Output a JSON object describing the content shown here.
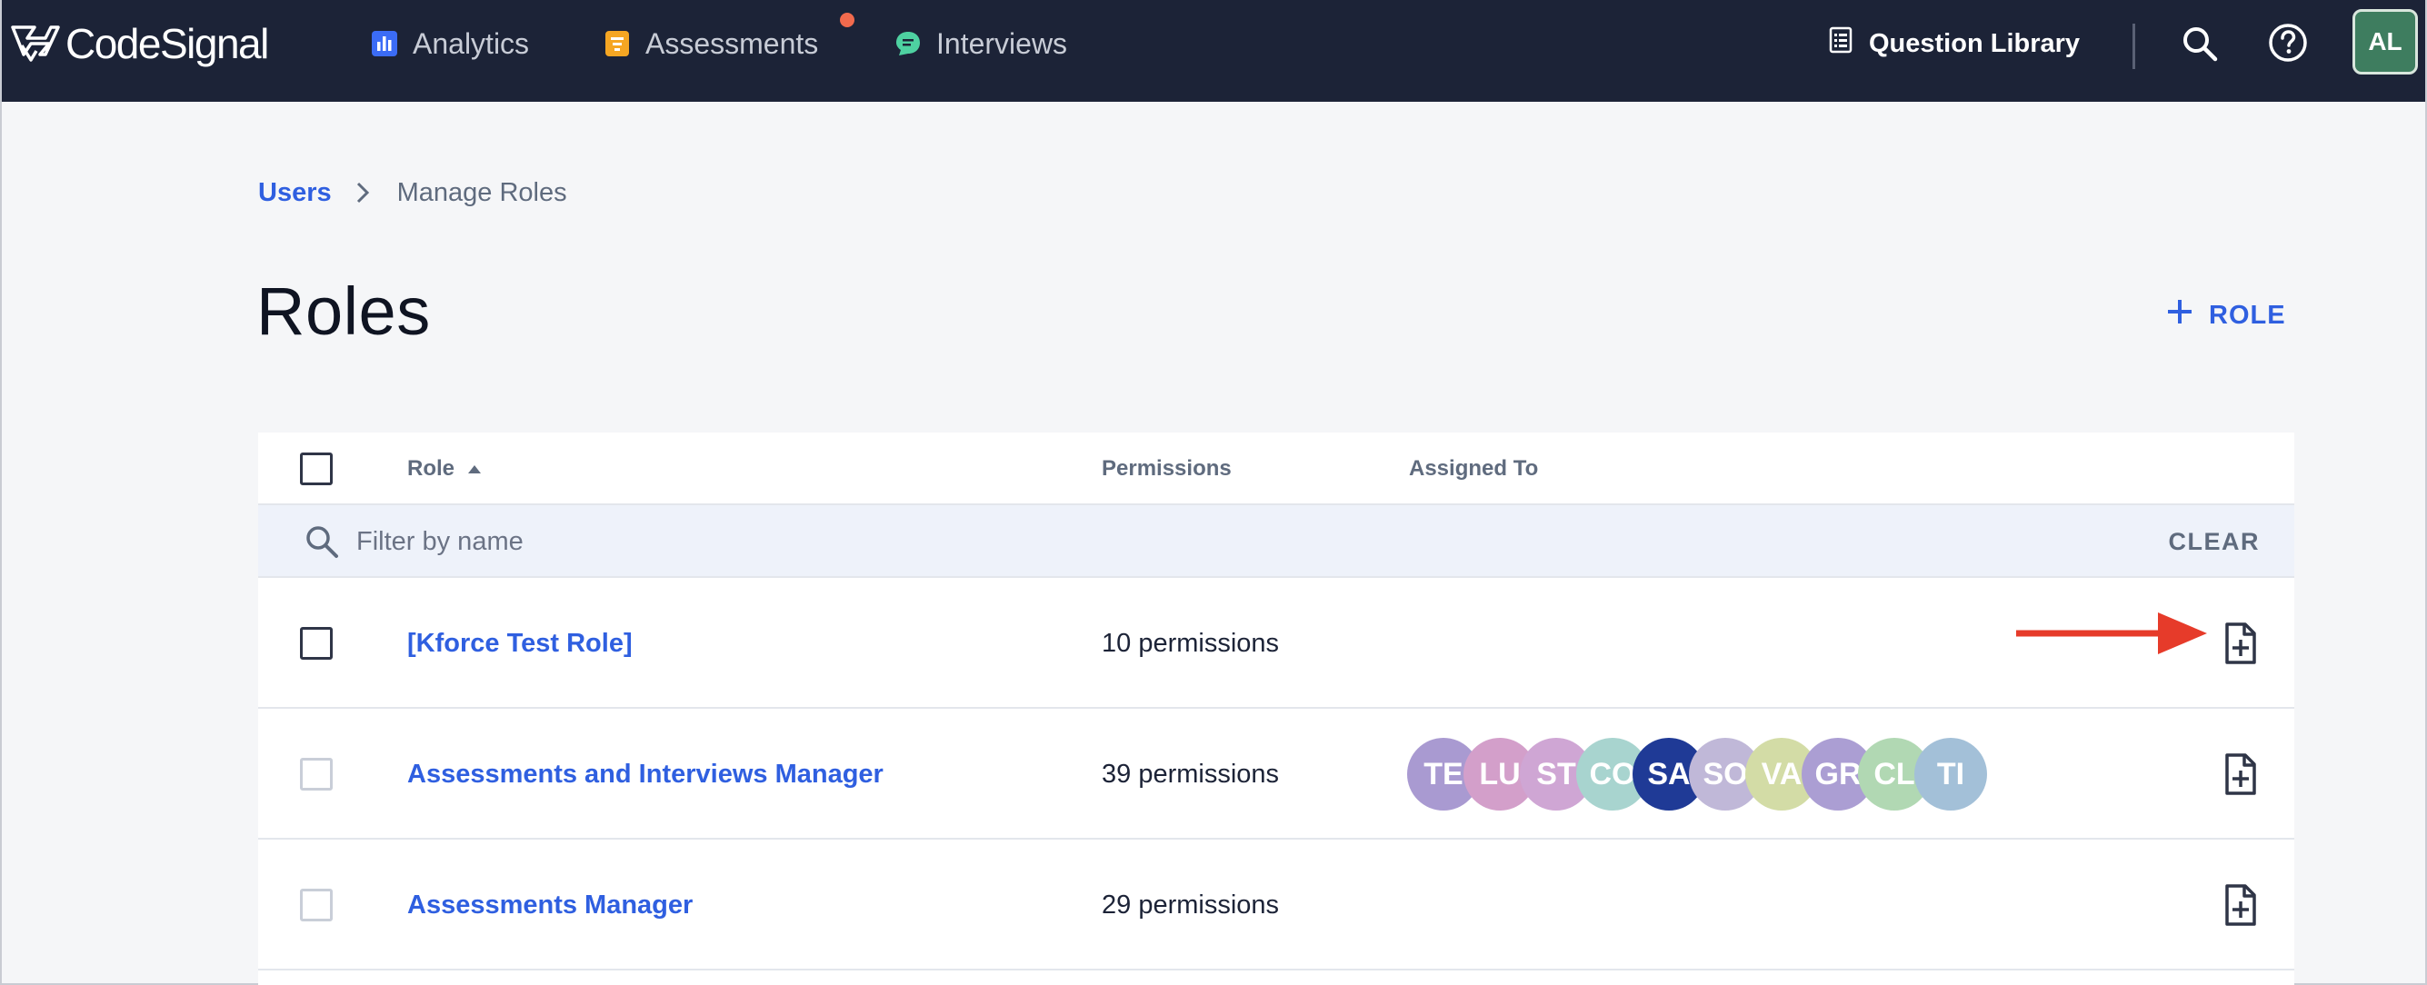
{
  "brand": {
    "name": "CodeSignal"
  },
  "nav": {
    "items": [
      {
        "label": "Analytics",
        "icon": "bar-chart-icon",
        "color": "#3b6cf6"
      },
      {
        "label": "Assessments",
        "icon": "assessment-icon",
        "color": "#f5a623",
        "notification": true
      },
      {
        "label": "Interviews",
        "icon": "chat-bubble-icon",
        "color": "#4ed1a1"
      }
    ],
    "question_library": "Question Library",
    "user_initials": "AL"
  },
  "breadcrumb": {
    "parent": "Users",
    "current": "Manage Roles"
  },
  "page": {
    "title": "Roles",
    "add_role_label": "ROLE"
  },
  "table": {
    "columns": {
      "role": "Role",
      "permissions": "Permissions",
      "assigned_to": "Assigned To"
    },
    "filter": {
      "placeholder": "Filter by name",
      "value": "",
      "clear_label": "CLEAR"
    },
    "rows": [
      {
        "name": "[Kforce Test Role]",
        "permissions": "10 permissions",
        "assigned": []
      },
      {
        "name": "Assessments and Interviews Manager",
        "permissions": "39 permissions",
        "assigned": [
          {
            "initials": "TE",
            "color": "#a99ad1"
          },
          {
            "initials": "LU",
            "color": "#d39fca"
          },
          {
            "initials": "ST",
            "color": "#cfa6d4"
          },
          {
            "initials": "CO",
            "color": "#a8d4cf"
          },
          {
            "initials": "SA",
            "color": "#1f3a96"
          },
          {
            "initials": "SO",
            "color": "#c0b8d8"
          },
          {
            "initials": "VA",
            "color": "#d3dca6"
          },
          {
            "initials": "GR",
            "color": "#ab9ed3"
          },
          {
            "initials": "CL",
            "color": "#b1d8b3"
          },
          {
            "initials": "TI",
            "color": "#a3c0d8"
          }
        ]
      },
      {
        "name": "Assessments Manager",
        "permissions": "29 permissions",
        "assigned": []
      }
    ]
  },
  "colors": {
    "accent": "#2f5fe0",
    "nav_bg": "#1c2337",
    "arrow": "#e63b2a"
  }
}
